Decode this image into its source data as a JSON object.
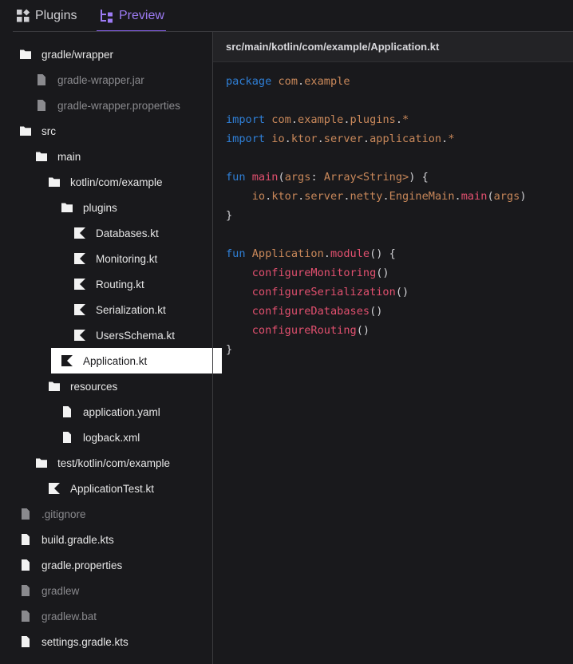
{
  "tabs": [
    {
      "label": "Plugins"
    },
    {
      "label": "Preview"
    }
  ],
  "tree": [
    {
      "label": "gradle/wrapper",
      "icon": "folder-icon",
      "dim": false,
      "selected": false
    },
    {
      "label": "gradle-wrapper.jar",
      "icon": "file-icon",
      "dim": true,
      "selected": false
    },
    {
      "label": "gradle-wrapper.properties",
      "icon": "file-icon",
      "dim": true,
      "selected": false
    },
    {
      "label": "src",
      "icon": "folder-icon",
      "dim": false,
      "selected": false
    },
    {
      "label": "main",
      "icon": "folder-icon",
      "dim": false,
      "selected": false
    },
    {
      "label": "kotlin/com/example",
      "icon": "folder-icon",
      "dim": false,
      "selected": false
    },
    {
      "label": "plugins",
      "icon": "folder-icon",
      "dim": false,
      "selected": false
    },
    {
      "label": "Databases.kt",
      "icon": "kotlin-icon",
      "dim": false,
      "selected": false
    },
    {
      "label": "Monitoring.kt",
      "icon": "kotlin-icon",
      "dim": false,
      "selected": false
    },
    {
      "label": "Routing.kt",
      "icon": "kotlin-icon",
      "dim": false,
      "selected": false
    },
    {
      "label": "Serialization.kt",
      "icon": "kotlin-icon",
      "dim": false,
      "selected": false
    },
    {
      "label": "UsersSchema.kt",
      "icon": "kotlin-icon",
      "dim": false,
      "selected": false
    },
    {
      "label": "Application.kt",
      "icon": "kotlin-icon",
      "dim": false,
      "selected": true
    },
    {
      "label": "resources",
      "icon": "folder-icon",
      "dim": false,
      "selected": false
    },
    {
      "label": "application.yaml",
      "icon": "file-icon",
      "dim": false,
      "selected": false
    },
    {
      "label": "logback.xml",
      "icon": "file-icon",
      "dim": false,
      "selected": false
    },
    {
      "label": "test/kotlin/com/example",
      "icon": "folder-icon",
      "dim": false,
      "selected": false
    },
    {
      "label": "ApplicationTest.kt",
      "icon": "kotlin-icon",
      "dim": false,
      "selected": false
    },
    {
      "label": ".gitignore",
      "icon": "file-icon",
      "dim": true,
      "selected": false
    },
    {
      "label": "build.gradle.kts",
      "icon": "file-icon",
      "dim": false,
      "selected": false
    },
    {
      "label": "gradle.properties",
      "icon": "file-icon",
      "dim": false,
      "selected": false
    },
    {
      "label": "gradlew",
      "icon": "file-icon",
      "dim": true,
      "selected": false
    },
    {
      "label": "gradlew.bat",
      "icon": "file-icon",
      "dim": true,
      "selected": false
    },
    {
      "label": "settings.gradle.kts",
      "icon": "file-icon",
      "dim": false,
      "selected": false
    }
  ],
  "code": {
    "path": "src/main/kotlin/com/example/Application.kt",
    "lines": [
      [
        [
          "kw",
          "package"
        ],
        [
          "pl",
          " "
        ],
        [
          "id",
          "com"
        ],
        [
          "pl",
          "."
        ],
        [
          "id",
          "example"
        ]
      ],
      [],
      [
        [
          "kw",
          "import"
        ],
        [
          "pl",
          " "
        ],
        [
          "id",
          "com"
        ],
        [
          "pl",
          "."
        ],
        [
          "id",
          "example"
        ],
        [
          "pl",
          "."
        ],
        [
          "id",
          "plugins"
        ],
        [
          "pl",
          "."
        ],
        [
          "id",
          "*"
        ]
      ],
      [
        [
          "kw",
          "import"
        ],
        [
          "pl",
          " "
        ],
        [
          "id",
          "io"
        ],
        [
          "pl",
          "."
        ],
        [
          "id",
          "ktor"
        ],
        [
          "pl",
          "."
        ],
        [
          "id",
          "server"
        ],
        [
          "pl",
          "."
        ],
        [
          "id",
          "application"
        ],
        [
          "pl",
          "."
        ],
        [
          "id",
          "*"
        ]
      ],
      [],
      [
        [
          "kw",
          "fun"
        ],
        [
          "pl",
          " "
        ],
        [
          "fn",
          "main"
        ],
        [
          "pl",
          "("
        ],
        [
          "id",
          "args"
        ],
        [
          "pl",
          ": "
        ],
        [
          "ty",
          "Array"
        ],
        [
          "gn",
          "<"
        ],
        [
          "ty",
          "String"
        ],
        [
          "gn",
          ">"
        ],
        [
          "pl",
          ") {"
        ]
      ],
      [
        [
          "pl",
          "    "
        ],
        [
          "id",
          "io"
        ],
        [
          "pl",
          "."
        ],
        [
          "id",
          "ktor"
        ],
        [
          "pl",
          "."
        ],
        [
          "id",
          "server"
        ],
        [
          "pl",
          "."
        ],
        [
          "id",
          "netty"
        ],
        [
          "pl",
          "."
        ],
        [
          "id",
          "EngineMain"
        ],
        [
          "pl",
          "."
        ],
        [
          "fn",
          "main"
        ],
        [
          "pl",
          "("
        ],
        [
          "id",
          "args"
        ],
        [
          "pl",
          ")"
        ]
      ],
      [
        [
          "pl",
          "}"
        ]
      ],
      [],
      [
        [
          "kw",
          "fun"
        ],
        [
          "pl",
          " "
        ],
        [
          "id",
          "Application"
        ],
        [
          "pl",
          "."
        ],
        [
          "fn",
          "module"
        ],
        [
          "pl",
          "() {"
        ]
      ],
      [
        [
          "pl",
          "    "
        ],
        [
          "fn",
          "configureMonitoring"
        ],
        [
          "pl",
          "()"
        ]
      ],
      [
        [
          "pl",
          "    "
        ],
        [
          "fn",
          "configureSerialization"
        ],
        [
          "pl",
          "()"
        ]
      ],
      [
        [
          "pl",
          "    "
        ],
        [
          "fn",
          "configureDatabases"
        ],
        [
          "pl",
          "()"
        ]
      ],
      [
        [
          "pl",
          "    "
        ],
        [
          "fn",
          "configureRouting"
        ],
        [
          "pl",
          "()"
        ]
      ],
      [
        [
          "pl",
          "}"
        ]
      ]
    ]
  }
}
